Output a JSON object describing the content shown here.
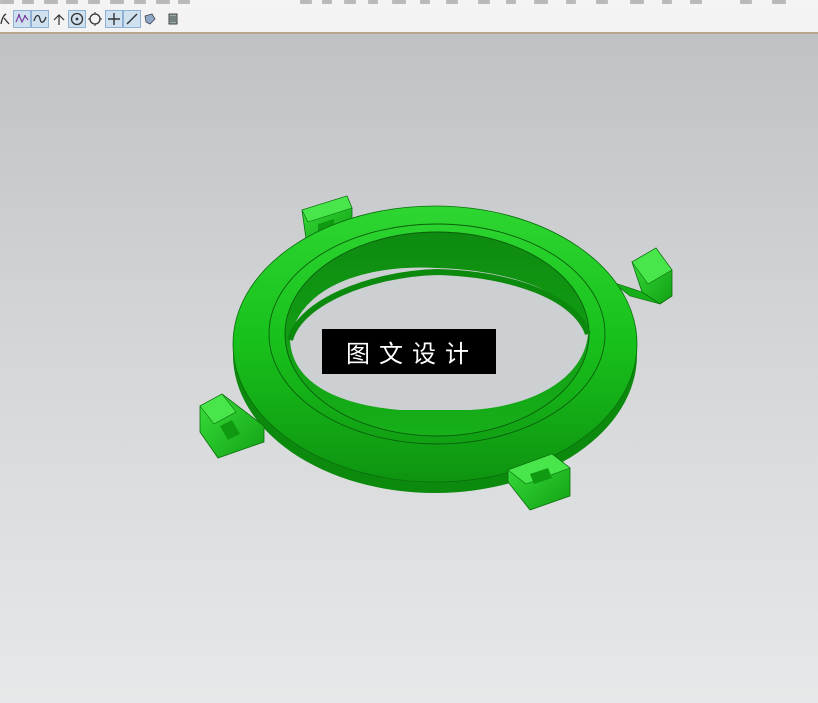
{
  "toolbar": {
    "tools": [
      {
        "icon": "curve-icon",
        "active": false
      },
      {
        "icon": "studio-spline-icon",
        "active": true
      },
      {
        "icon": "spline-icon",
        "active": true
      },
      {
        "icon": "profile-icon",
        "active": false
      },
      {
        "icon": "circle-center-icon",
        "active": true
      },
      {
        "icon": "circle-icon",
        "active": false
      },
      {
        "icon": "point-icon",
        "active": true
      },
      {
        "icon": "line-icon",
        "active": true
      },
      {
        "icon": "shape-icon",
        "active": false
      },
      {
        "icon": "layer-icon",
        "active": false
      }
    ]
  },
  "viewport": {
    "model_color": "#19c41c",
    "background_top": "#bfc2c4",
    "background_bottom": "#e6e8e9"
  },
  "watermark": {
    "text": "图文设计"
  }
}
